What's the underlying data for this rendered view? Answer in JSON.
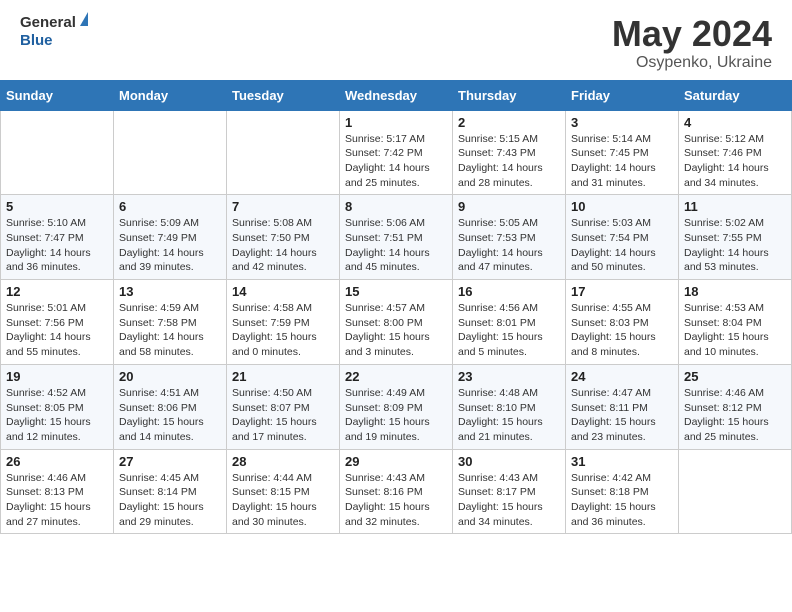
{
  "header": {
    "logo_line1": "General",
    "logo_line2": "Blue",
    "month": "May 2024",
    "location": "Osypenko, Ukraine"
  },
  "weekdays": [
    "Sunday",
    "Monday",
    "Tuesday",
    "Wednesday",
    "Thursday",
    "Friday",
    "Saturday"
  ],
  "weeks": [
    [
      null,
      null,
      null,
      {
        "day": "1",
        "sunrise": "5:17 AM",
        "sunset": "7:42 PM",
        "daylight": "14 hours and 25 minutes."
      },
      {
        "day": "2",
        "sunrise": "5:15 AM",
        "sunset": "7:43 PM",
        "daylight": "14 hours and 28 minutes."
      },
      {
        "day": "3",
        "sunrise": "5:14 AM",
        "sunset": "7:45 PM",
        "daylight": "14 hours and 31 minutes."
      },
      {
        "day": "4",
        "sunrise": "5:12 AM",
        "sunset": "7:46 PM",
        "daylight": "14 hours and 34 minutes."
      }
    ],
    [
      {
        "day": "5",
        "sunrise": "5:10 AM",
        "sunset": "7:47 PM",
        "daylight": "14 hours and 36 minutes."
      },
      {
        "day": "6",
        "sunrise": "5:09 AM",
        "sunset": "7:49 PM",
        "daylight": "14 hours and 39 minutes."
      },
      {
        "day": "7",
        "sunrise": "5:08 AM",
        "sunset": "7:50 PM",
        "daylight": "14 hours and 42 minutes."
      },
      {
        "day": "8",
        "sunrise": "5:06 AM",
        "sunset": "7:51 PM",
        "daylight": "14 hours and 45 minutes."
      },
      {
        "day": "9",
        "sunrise": "5:05 AM",
        "sunset": "7:53 PM",
        "daylight": "14 hours and 47 minutes."
      },
      {
        "day": "10",
        "sunrise": "5:03 AM",
        "sunset": "7:54 PM",
        "daylight": "14 hours and 50 minutes."
      },
      {
        "day": "11",
        "sunrise": "5:02 AM",
        "sunset": "7:55 PM",
        "daylight": "14 hours and 53 minutes."
      }
    ],
    [
      {
        "day": "12",
        "sunrise": "5:01 AM",
        "sunset": "7:56 PM",
        "daylight": "14 hours and 55 minutes."
      },
      {
        "day": "13",
        "sunrise": "4:59 AM",
        "sunset": "7:58 PM",
        "daylight": "14 hours and 58 minutes."
      },
      {
        "day": "14",
        "sunrise": "4:58 AM",
        "sunset": "7:59 PM",
        "daylight": "15 hours and 0 minutes."
      },
      {
        "day": "15",
        "sunrise": "4:57 AM",
        "sunset": "8:00 PM",
        "daylight": "15 hours and 3 minutes."
      },
      {
        "day": "16",
        "sunrise": "4:56 AM",
        "sunset": "8:01 PM",
        "daylight": "15 hours and 5 minutes."
      },
      {
        "day": "17",
        "sunrise": "4:55 AM",
        "sunset": "8:03 PM",
        "daylight": "15 hours and 8 minutes."
      },
      {
        "day": "18",
        "sunrise": "4:53 AM",
        "sunset": "8:04 PM",
        "daylight": "15 hours and 10 minutes."
      }
    ],
    [
      {
        "day": "19",
        "sunrise": "4:52 AM",
        "sunset": "8:05 PM",
        "daylight": "15 hours and 12 minutes."
      },
      {
        "day": "20",
        "sunrise": "4:51 AM",
        "sunset": "8:06 PM",
        "daylight": "15 hours and 14 minutes."
      },
      {
        "day": "21",
        "sunrise": "4:50 AM",
        "sunset": "8:07 PM",
        "daylight": "15 hours and 17 minutes."
      },
      {
        "day": "22",
        "sunrise": "4:49 AM",
        "sunset": "8:09 PM",
        "daylight": "15 hours and 19 minutes."
      },
      {
        "day": "23",
        "sunrise": "4:48 AM",
        "sunset": "8:10 PM",
        "daylight": "15 hours and 21 minutes."
      },
      {
        "day": "24",
        "sunrise": "4:47 AM",
        "sunset": "8:11 PM",
        "daylight": "15 hours and 23 minutes."
      },
      {
        "day": "25",
        "sunrise": "4:46 AM",
        "sunset": "8:12 PM",
        "daylight": "15 hours and 25 minutes."
      }
    ],
    [
      {
        "day": "26",
        "sunrise": "4:46 AM",
        "sunset": "8:13 PM",
        "daylight": "15 hours and 27 minutes."
      },
      {
        "day": "27",
        "sunrise": "4:45 AM",
        "sunset": "8:14 PM",
        "daylight": "15 hours and 29 minutes."
      },
      {
        "day": "28",
        "sunrise": "4:44 AM",
        "sunset": "8:15 PM",
        "daylight": "15 hours and 30 minutes."
      },
      {
        "day": "29",
        "sunrise": "4:43 AM",
        "sunset": "8:16 PM",
        "daylight": "15 hours and 32 minutes."
      },
      {
        "day": "30",
        "sunrise": "4:43 AM",
        "sunset": "8:17 PM",
        "daylight": "15 hours and 34 minutes."
      },
      {
        "day": "31",
        "sunrise": "4:42 AM",
        "sunset": "8:18 PM",
        "daylight": "15 hours and 36 minutes."
      },
      null
    ]
  ]
}
